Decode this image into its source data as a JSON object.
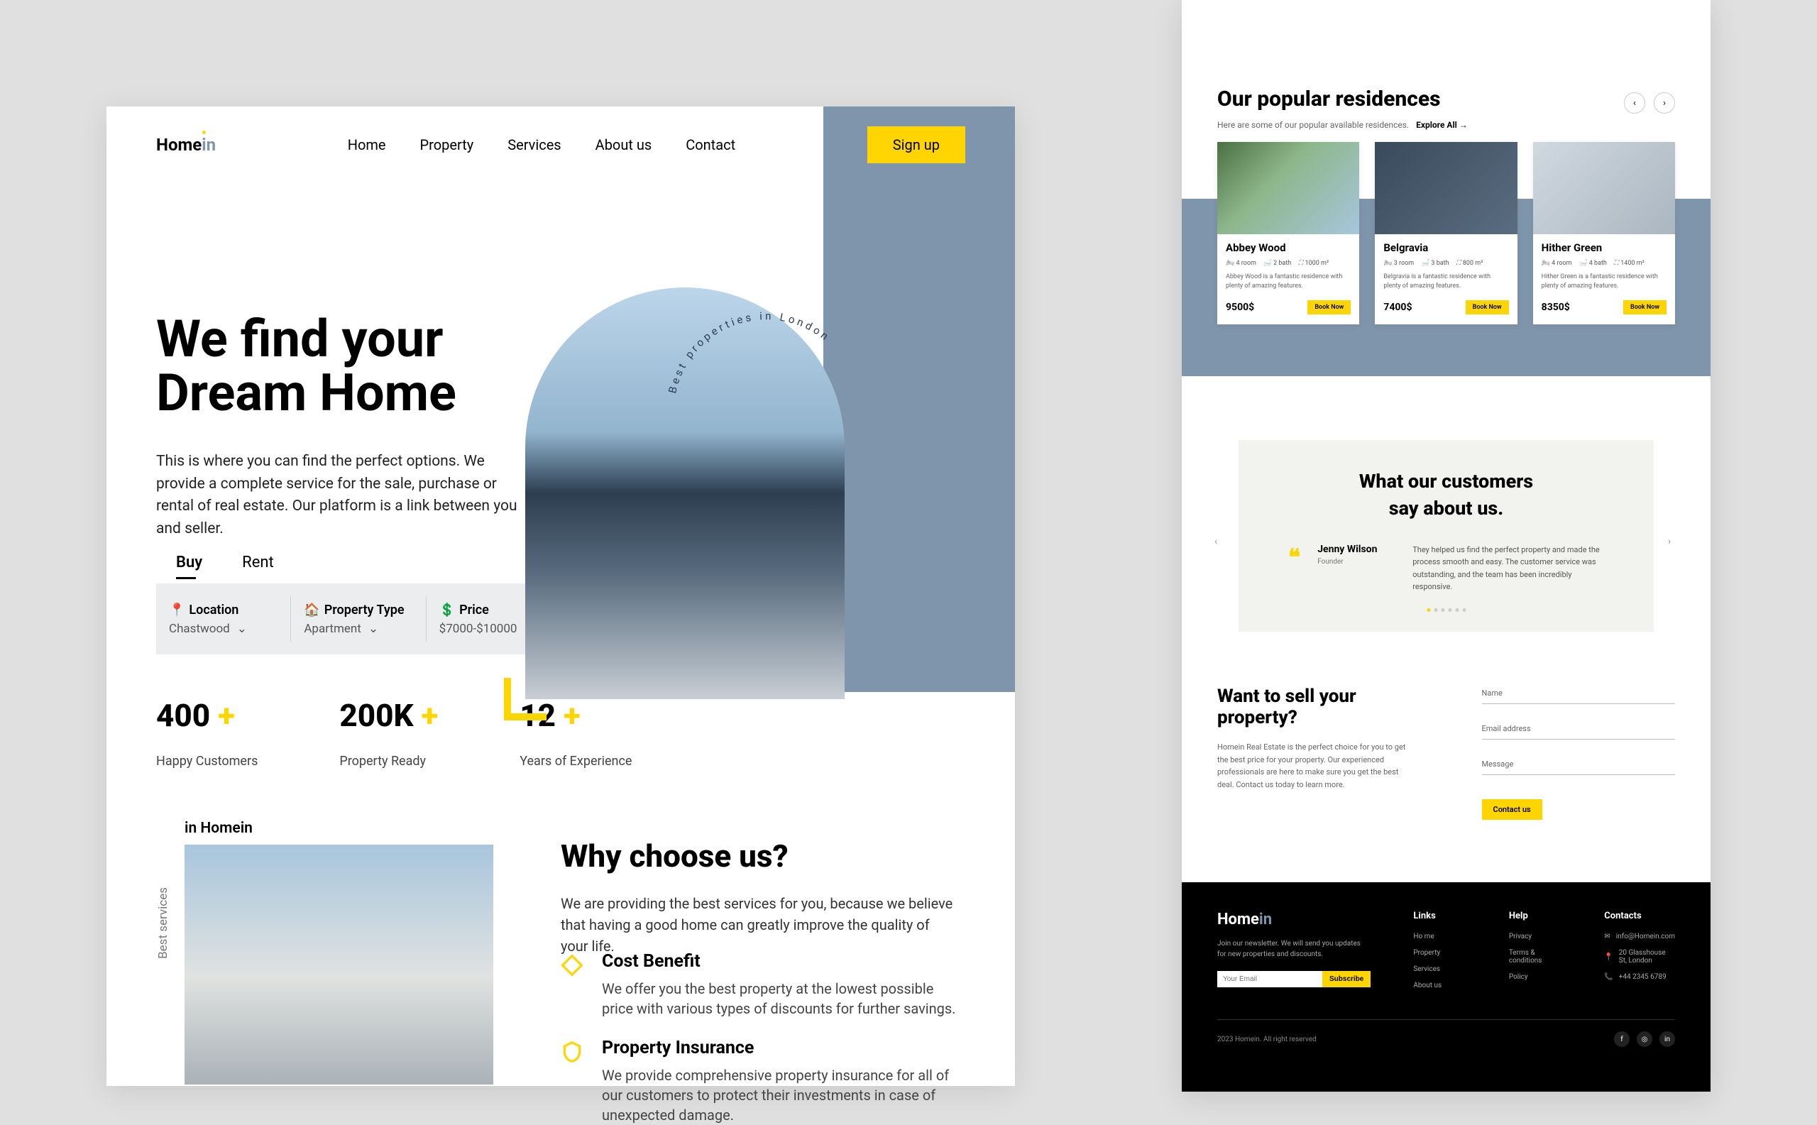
{
  "brandA": "Home",
  "brandB": "in",
  "nav": [
    "Home",
    "Property",
    "Services",
    "About us",
    "Contact"
  ],
  "signup": "Sign up",
  "heroA": "We find your",
  "heroB": "Dream Home",
  "heroSub": "This is where you can find the perfect options. We provide a complete service for the sale, purchase or rental of real estate. Our platform is a link between you and seller.",
  "tabs": [
    "Buy",
    "Rent"
  ],
  "search": {
    "locL": "Location",
    "locV": "Chastwood",
    "typL": "Property Type",
    "typV": "Apartment",
    "priL": "Price",
    "priV": "$7000-$10000"
  },
  "stats": [
    {
      "n": "400",
      "l": "Happy Customers"
    },
    {
      "n": "200K",
      "l": "Property Ready"
    },
    {
      "n": "12",
      "l": "Years of Experience"
    }
  ],
  "curveText": "Best properties in London",
  "bsSide": "Best services",
  "bsTitle": "in Homein",
  "why": {
    "title": "Why choose us?",
    "sub": "We are providing the best services for you, because we believe that having a good home can greatly improve the quality of your life.",
    "f1t": "Cost Benefit",
    "f1d": "We offer you the best property at the lowest possible price with various types of discounts for further savings.",
    "f2t": "Property Insurance",
    "f2d": "We provide comprehensive property insurance for all of our customers to protect their investments in case of unexpected damage."
  },
  "pop": {
    "title": "Our popular residences",
    "sub": "Here are some of our popular available residences.",
    "explore": "Explore All →"
  },
  "cards": [
    {
      "name": "Abbey Wood",
      "room": "4 room",
      "bath": "2 bath",
      "area": "1000 m²",
      "desc": "Abbey Wood is a fantastic residence with plenty of amazing features.",
      "price": "9500$"
    },
    {
      "name": "Belgravia",
      "room": "3 room",
      "bath": "3 bath",
      "area": "800 m²",
      "desc": "Belgravia is a fantastic residence with plenty of amazing features.",
      "price": "7400$"
    },
    {
      "name": "Hither Green",
      "room": "4 room",
      "bath": "4 bath",
      "area": "1400 m²",
      "desc": "Hither Green is a fantastic residence with plenty of amazing features.",
      "price": "8350$"
    }
  ],
  "bookNow": "Book Now",
  "testi": {
    "t1": "What our customers",
    "t2": "say about us.",
    "name": "Jenny Wilson",
    "role": "Founder",
    "text": "They helped us find the perfect property and made the process smooth and easy. The customer service was outstanding, and the team has been incredibly responsive."
  },
  "sell": {
    "title": "Want to sell your property?",
    "text": "Homein Real Estate is the perfect choice for you to get the best price for your property. Our experienced professionals are here to make sure you get the best deal. Contact us today to learn more.",
    "name": "Name",
    "email": "Email address",
    "msg": "Message",
    "btn": "Contact us"
  },
  "footer": {
    "news": "Join our newsletter. We will send you updates for new properties and discounts.",
    "emailPh": "Your Email",
    "sub": "Subscribe",
    "linksH": "Links",
    "links": [
      "Ho me",
      "Property",
      "Services",
      "About us"
    ],
    "helpH": "Help",
    "help": [
      "Privacy",
      "Terms & conditions",
      "Policy"
    ],
    "contH": "Contacts",
    "cEmail": "info@Homein.com",
    "cAddr": "20 Glasshouse St, London",
    "cPhone": "+44 2345 6789",
    "copy": "2023 Homein. All right reserved"
  }
}
